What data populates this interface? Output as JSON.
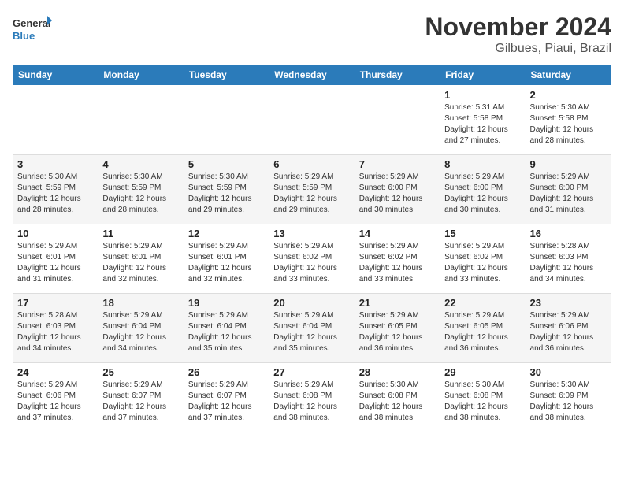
{
  "header": {
    "logo_line1": "General",
    "logo_line2": "Blue",
    "month": "November 2024",
    "location": "Gilbues, Piaui, Brazil"
  },
  "weekdays": [
    "Sunday",
    "Monday",
    "Tuesday",
    "Wednesday",
    "Thursday",
    "Friday",
    "Saturday"
  ],
  "weeks": [
    [
      {
        "day": "",
        "info": ""
      },
      {
        "day": "",
        "info": ""
      },
      {
        "day": "",
        "info": ""
      },
      {
        "day": "",
        "info": ""
      },
      {
        "day": "",
        "info": ""
      },
      {
        "day": "1",
        "info": "Sunrise: 5:31 AM\nSunset: 5:58 PM\nDaylight: 12 hours and 27 minutes."
      },
      {
        "day": "2",
        "info": "Sunrise: 5:30 AM\nSunset: 5:58 PM\nDaylight: 12 hours and 28 minutes."
      }
    ],
    [
      {
        "day": "3",
        "info": "Sunrise: 5:30 AM\nSunset: 5:59 PM\nDaylight: 12 hours and 28 minutes."
      },
      {
        "day": "4",
        "info": "Sunrise: 5:30 AM\nSunset: 5:59 PM\nDaylight: 12 hours and 28 minutes."
      },
      {
        "day": "5",
        "info": "Sunrise: 5:30 AM\nSunset: 5:59 PM\nDaylight: 12 hours and 29 minutes."
      },
      {
        "day": "6",
        "info": "Sunrise: 5:29 AM\nSunset: 5:59 PM\nDaylight: 12 hours and 29 minutes."
      },
      {
        "day": "7",
        "info": "Sunrise: 5:29 AM\nSunset: 6:00 PM\nDaylight: 12 hours and 30 minutes."
      },
      {
        "day": "8",
        "info": "Sunrise: 5:29 AM\nSunset: 6:00 PM\nDaylight: 12 hours and 30 minutes."
      },
      {
        "day": "9",
        "info": "Sunrise: 5:29 AM\nSunset: 6:00 PM\nDaylight: 12 hours and 31 minutes."
      }
    ],
    [
      {
        "day": "10",
        "info": "Sunrise: 5:29 AM\nSunset: 6:01 PM\nDaylight: 12 hours and 31 minutes."
      },
      {
        "day": "11",
        "info": "Sunrise: 5:29 AM\nSunset: 6:01 PM\nDaylight: 12 hours and 32 minutes."
      },
      {
        "day": "12",
        "info": "Sunrise: 5:29 AM\nSunset: 6:01 PM\nDaylight: 12 hours and 32 minutes."
      },
      {
        "day": "13",
        "info": "Sunrise: 5:29 AM\nSunset: 6:02 PM\nDaylight: 12 hours and 33 minutes."
      },
      {
        "day": "14",
        "info": "Sunrise: 5:29 AM\nSunset: 6:02 PM\nDaylight: 12 hours and 33 minutes."
      },
      {
        "day": "15",
        "info": "Sunrise: 5:29 AM\nSunset: 6:02 PM\nDaylight: 12 hours and 33 minutes."
      },
      {
        "day": "16",
        "info": "Sunrise: 5:28 AM\nSunset: 6:03 PM\nDaylight: 12 hours and 34 minutes."
      }
    ],
    [
      {
        "day": "17",
        "info": "Sunrise: 5:28 AM\nSunset: 6:03 PM\nDaylight: 12 hours and 34 minutes."
      },
      {
        "day": "18",
        "info": "Sunrise: 5:29 AM\nSunset: 6:04 PM\nDaylight: 12 hours and 34 minutes."
      },
      {
        "day": "19",
        "info": "Sunrise: 5:29 AM\nSunset: 6:04 PM\nDaylight: 12 hours and 35 minutes."
      },
      {
        "day": "20",
        "info": "Sunrise: 5:29 AM\nSunset: 6:04 PM\nDaylight: 12 hours and 35 minutes."
      },
      {
        "day": "21",
        "info": "Sunrise: 5:29 AM\nSunset: 6:05 PM\nDaylight: 12 hours and 36 minutes."
      },
      {
        "day": "22",
        "info": "Sunrise: 5:29 AM\nSunset: 6:05 PM\nDaylight: 12 hours and 36 minutes."
      },
      {
        "day": "23",
        "info": "Sunrise: 5:29 AM\nSunset: 6:06 PM\nDaylight: 12 hours and 36 minutes."
      }
    ],
    [
      {
        "day": "24",
        "info": "Sunrise: 5:29 AM\nSunset: 6:06 PM\nDaylight: 12 hours and 37 minutes."
      },
      {
        "day": "25",
        "info": "Sunrise: 5:29 AM\nSunset: 6:07 PM\nDaylight: 12 hours and 37 minutes."
      },
      {
        "day": "26",
        "info": "Sunrise: 5:29 AM\nSunset: 6:07 PM\nDaylight: 12 hours and 37 minutes."
      },
      {
        "day": "27",
        "info": "Sunrise: 5:29 AM\nSunset: 6:08 PM\nDaylight: 12 hours and 38 minutes."
      },
      {
        "day": "28",
        "info": "Sunrise: 5:30 AM\nSunset: 6:08 PM\nDaylight: 12 hours and 38 minutes."
      },
      {
        "day": "29",
        "info": "Sunrise: 5:30 AM\nSunset: 6:08 PM\nDaylight: 12 hours and 38 minutes."
      },
      {
        "day": "30",
        "info": "Sunrise: 5:30 AM\nSunset: 6:09 PM\nDaylight: 12 hours and 38 minutes."
      }
    ]
  ]
}
